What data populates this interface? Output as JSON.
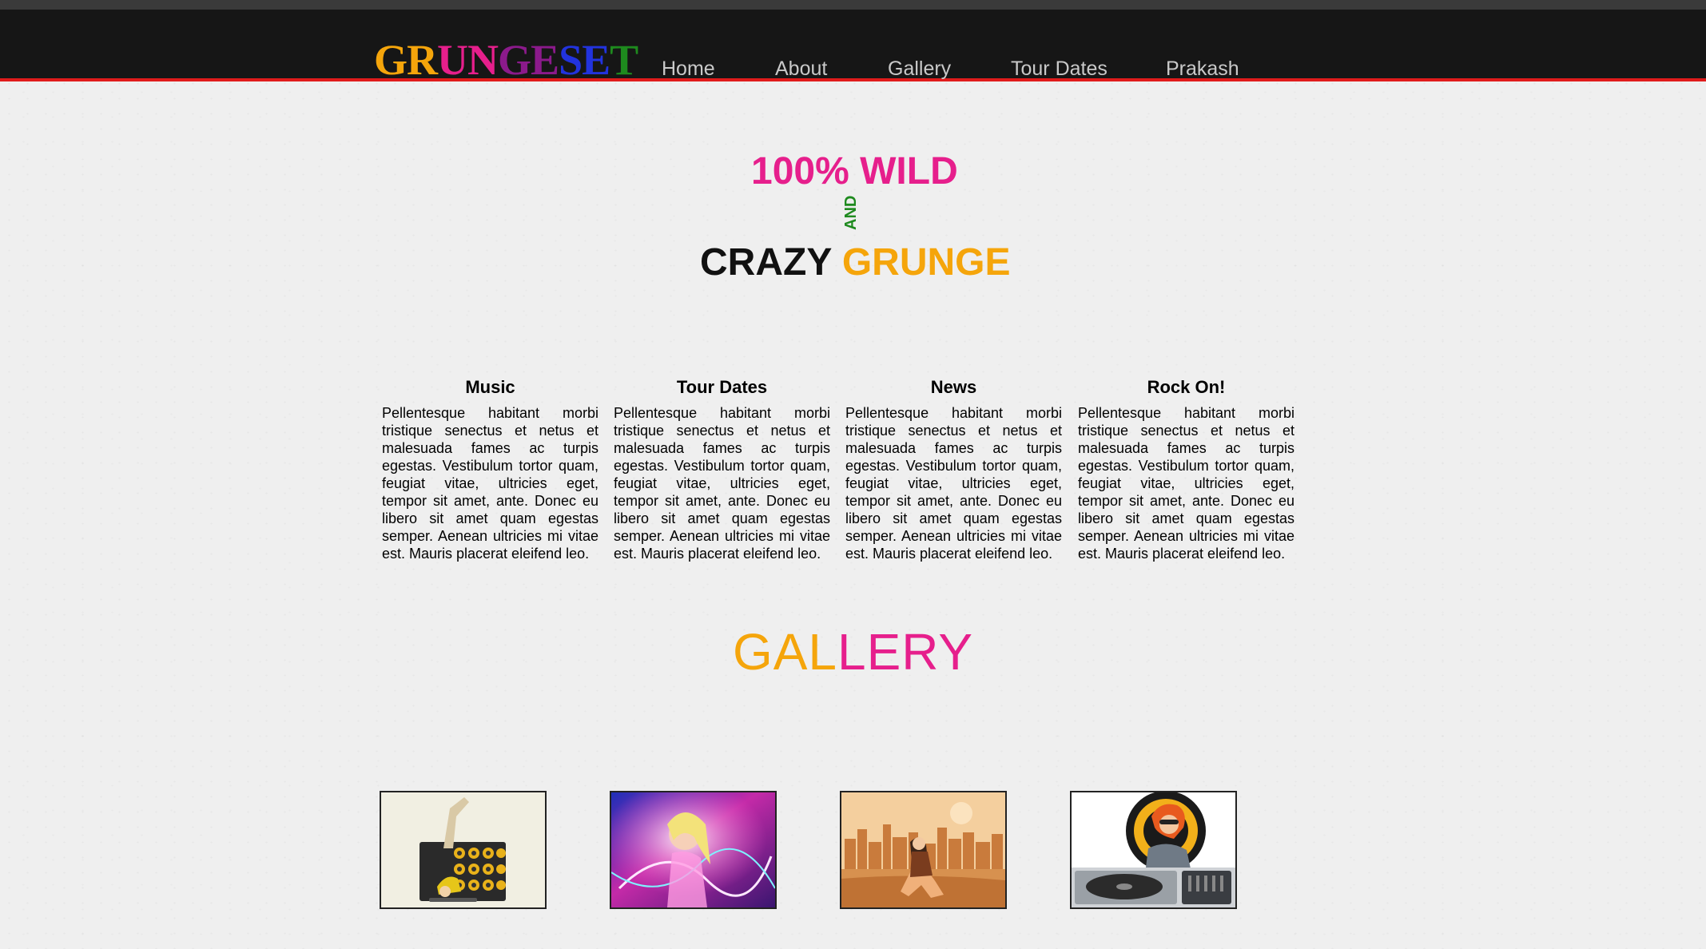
{
  "header": {
    "logo": {
      "letters": [
        {
          "char": "G",
          "color": "#f5a50b"
        },
        {
          "char": "R",
          "color": "#f5a50b"
        },
        {
          "char": "U",
          "color": "#e61f8c"
        },
        {
          "char": "N",
          "color": "#e61f8c"
        },
        {
          "char": "G",
          "color": "#8b1a8b"
        },
        {
          "char": "E",
          "color": "#8b1a8b"
        },
        {
          "char": "S",
          "color": "#2233dd"
        },
        {
          "char": "E",
          "color": "#2233dd"
        },
        {
          "char": "T",
          "color": "#1e8a1e"
        }
      ]
    },
    "nav": [
      "Home",
      "About",
      "Gallery",
      "Tour Dates",
      "Prakash"
    ],
    "accent_color": "#e01b1b"
  },
  "hero": {
    "line1": "100% WILD",
    "connector": "AND",
    "line2_part1": "CRAZY",
    "line2_part2": "GRUNGE"
  },
  "features": [
    {
      "title": "Music",
      "body": "Pellentesque habitant morbi tristique senectus et netus et malesuada fames ac turpis egestas. Vestibulum tortor quam, feugiat vitae, ultricies eget, tempor sit amet, ante. Donec eu libero sit amet quam egestas semper. Aenean ultricies mi vitae est. Mauris placerat eleifend leo."
    },
    {
      "title": "Tour Dates",
      "body": "Pellentesque habitant morbi tristique senectus et netus et malesuada fames ac turpis egestas. Vestibulum tortor quam, feugiat vitae, ultricies eget, tempor sit amet, ante. Donec eu libero sit amet quam egestas semper. Aenean ultricies mi vitae est. Mauris placerat eleifend leo."
    },
    {
      "title": "News",
      "body": "Pellentesque habitant morbi tristique senectus et netus et malesuada fames ac turpis egestas. Vestibulum tortor quam, feugiat vitae, ultricies eget, tempor sit amet, ante. Donec eu libero sit amet quam egestas semper. Aenean ultricies mi vitae est. Mauris placerat eleifend leo."
    },
    {
      "title": "Rock On!",
      "body": "Pellentesque habitant morbi tristique senectus et netus et malesuada fames ac turpis egestas. Vestibulum tortor quam, feugiat vitae, ultricies eget, tempor sit amet, ante. Donec eu libero sit amet quam egestas semper. Aenean ultricies mi vitae est. Mauris placerat eleifend leo."
    }
  ],
  "gallery": {
    "title_part1": "GAL",
    "title_part2": "LERY",
    "images": [
      {
        "name": "breakdancer-speakers-image"
      },
      {
        "name": "neon-girl-flow-image"
      },
      {
        "name": "city-skyline-girl-image"
      },
      {
        "name": "dj-turntable-image"
      }
    ]
  }
}
